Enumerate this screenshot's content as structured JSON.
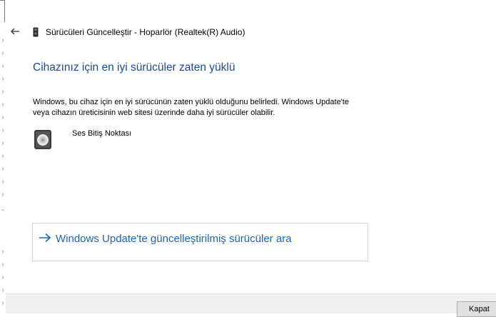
{
  "window": {
    "title": "Sürücüleri Güncelleştir - Hoparlör (Realtek(R) Audio)"
  },
  "nav": {
    "back_icon": "back-arrow-icon"
  },
  "content": {
    "heading": "Cihazınız için en iyi sürücüler zaten yüklü",
    "description_line1": "Windows, bu cihaz için en iyi sürücünün zaten yüklü olduğunu belirledi. Windows Update'te",
    "description_line2": "veya cihazın üreticisinin web sitesi üzerinde daha iyi sürücüler olabilir.",
    "device_name": "Ses Bitiş Noktası",
    "link_text": "Windows Update'te güncelleştirilmiş sürücüler ara"
  },
  "footer": {
    "close_label": "Kapat"
  },
  "colors": {
    "heading": "#1a4a8e",
    "link": "#1a64b6",
    "footer_bg": "#f0f0f0"
  }
}
